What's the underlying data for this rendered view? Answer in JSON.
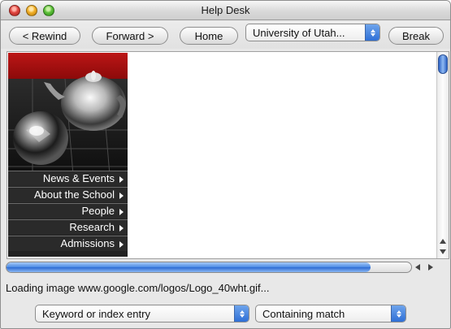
{
  "window": {
    "title": "Help Desk"
  },
  "toolbar": {
    "rewind": "< Rewind",
    "forward": "Forward >",
    "home": "Home",
    "site_select": "University of Utah...",
    "break": "Break"
  },
  "web_page": {
    "menu": [
      "News & Events",
      "About the School",
      "People",
      "Research",
      "Admissions"
    ]
  },
  "progress": {
    "fraction": 0.9
  },
  "status": {
    "text": "Loading image www.google.com/logos/Logo_40wht.gif..."
  },
  "search": {
    "field_select": "Keyword or index entry",
    "match_select": "Containing match"
  },
  "colors": {
    "accent": "#3a7ee0",
    "banner_red": "#a80f0f"
  }
}
